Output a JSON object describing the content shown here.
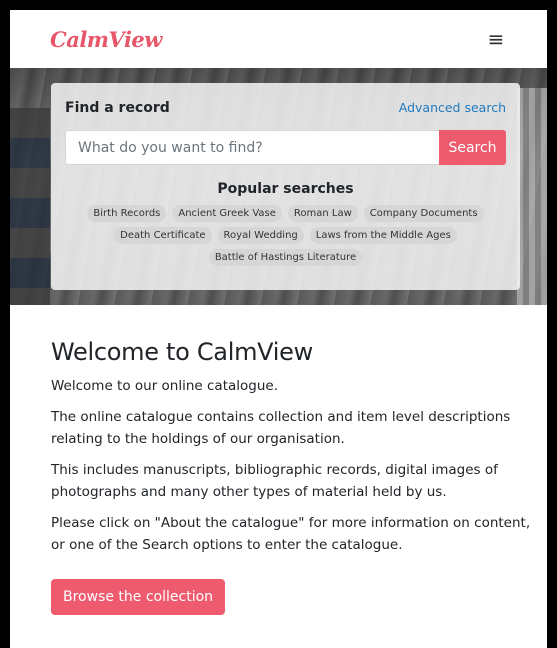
{
  "header": {
    "logo": "CalmView",
    "menu_icon": "hamburger-icon",
    "menu_glyph": "≡"
  },
  "search": {
    "title": "Find a record",
    "advanced_label": "Advanced search",
    "placeholder": "What do you want to find?",
    "button_label": "Search",
    "popular_title": "Popular searches",
    "popular": [
      "Birth Records",
      "Ancient Greek Vase",
      "Roman Law",
      "Company Documents",
      "Death Certificate",
      "Royal Wedding",
      "Laws from the Middle Ages",
      "Battle of Hastings Literature"
    ]
  },
  "main": {
    "title": "Welcome to CalmView",
    "paragraphs": [
      "Welcome to our online catalogue.",
      "The online catalogue contains collection and item level descriptions relating to the holdings of our organisation.",
      "This includes manuscripts, bibliographic records, digital images of photographs and many other types of material held by us.",
      "Please click on \"About the catalogue\" for more information on content, or one of the Search options to enter the catalogue."
    ],
    "browse_label": "Browse the collection"
  },
  "colors": {
    "accent": "#ef5b6e",
    "logo": "#e8566a",
    "link": "#1f7bc1",
    "tag_bg": "#d6d6d6"
  }
}
